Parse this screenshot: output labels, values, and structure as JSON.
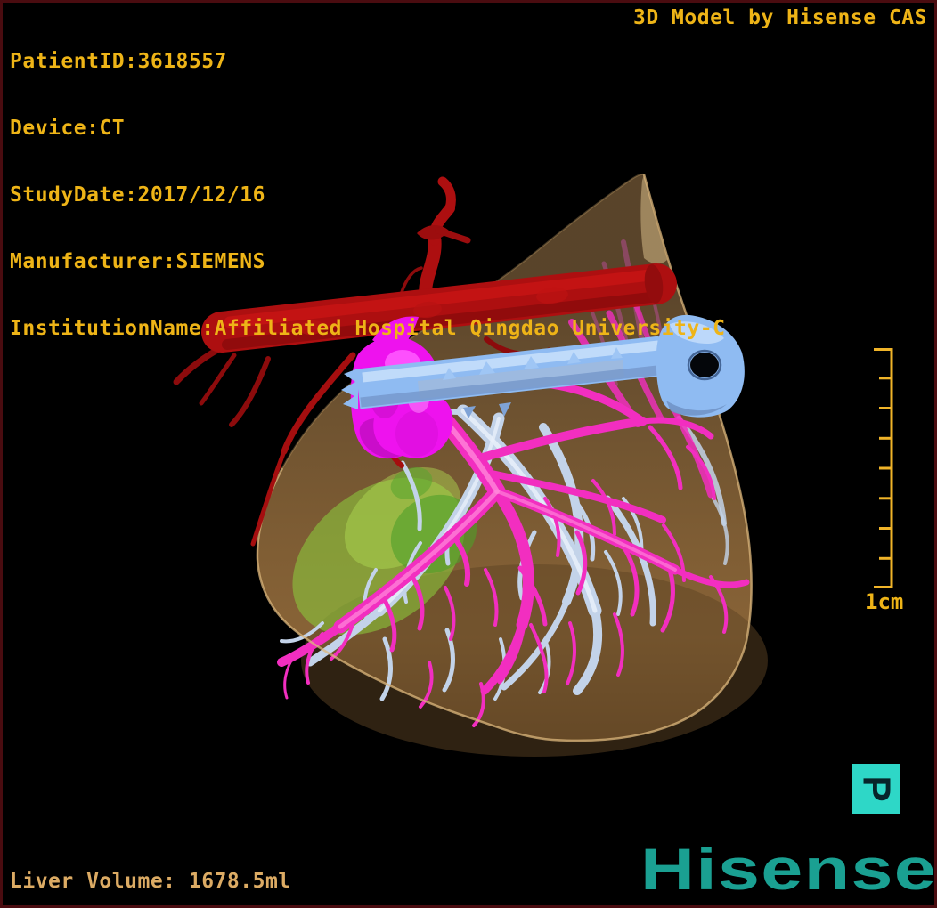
{
  "patient": {
    "lines": [
      "PatientID:3618557",
      "Device:CT",
      "StudyDate:2017/12/16",
      "Manufacturer:SIEMENS",
      "InstitutionName:Affiliated Hospital Qingdao University-C"
    ]
  },
  "watermark": {
    "title": "3D Model by Hisense CAS"
  },
  "scale": {
    "label": "1cm"
  },
  "stats": {
    "liver_volume": "Liver Volume: 1678.5ml"
  },
  "branding": {
    "logo_text": "Hisense",
    "icon_letter": "P"
  },
  "colors": {
    "overlay_text": "#eeb417",
    "volume_text": "#dcab64",
    "scale_bar": "#f0b429",
    "frame_border": "#4a0c10",
    "background": "#000000",
    "logo_teal": "#1aa092",
    "icon_turquoise": "#2ed7c7",
    "liver_surface": "#a87a45",
    "red_vessel": "#ad0f10",
    "pink_vessel_network": "#f22ec0",
    "pale_blue_vessel_network": "#c3d3e9",
    "light_blue_main_vein": "#8fbbf2",
    "magenta_structure": "#ee12ee",
    "green_structure": "#8cc93c"
  }
}
